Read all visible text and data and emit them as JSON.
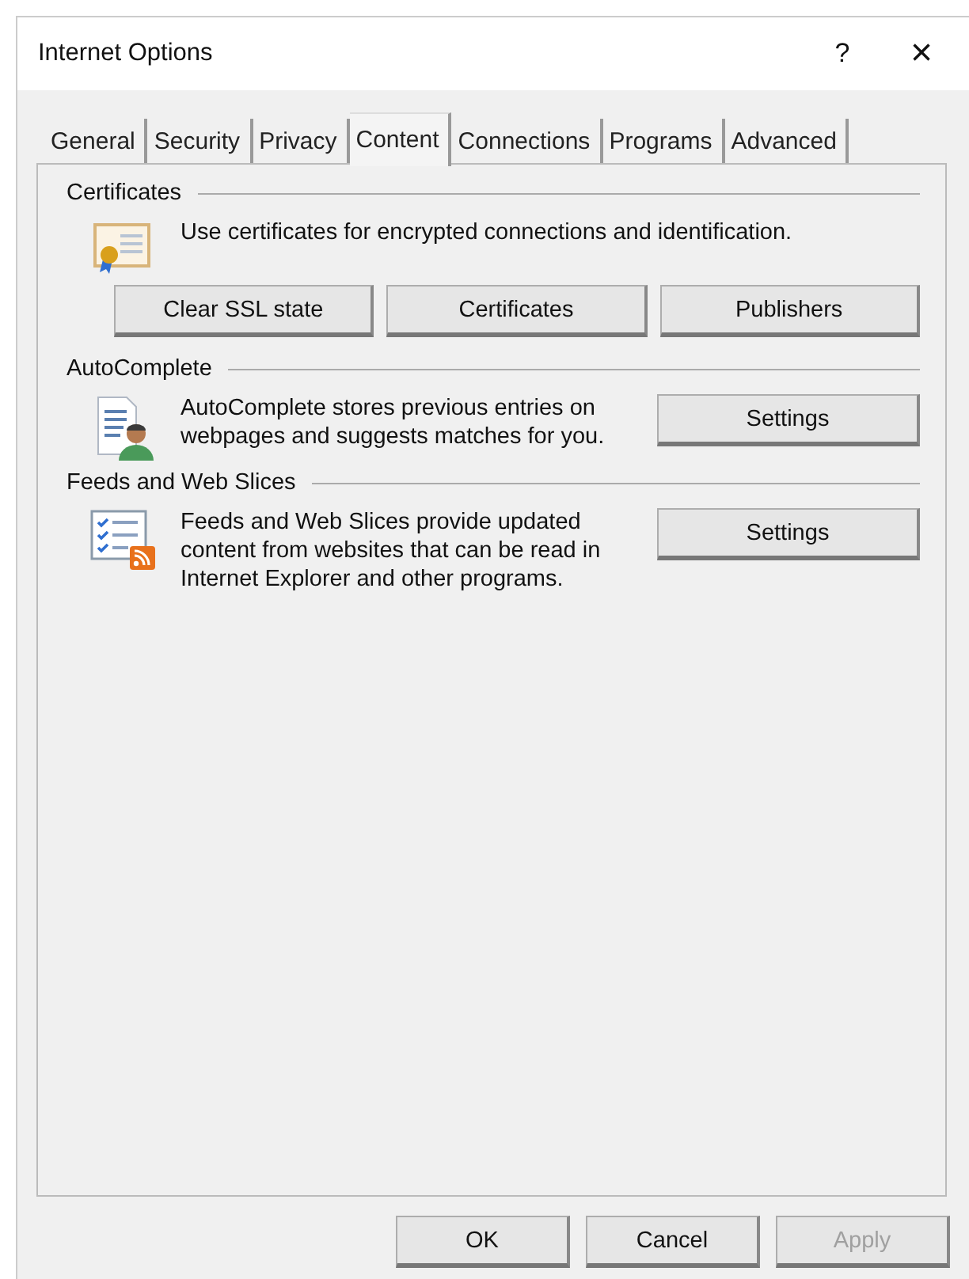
{
  "window": {
    "title": "Internet Options",
    "help": "?",
    "close": "×"
  },
  "tabs": [
    {
      "label": "General",
      "selected": false
    },
    {
      "label": "Security",
      "selected": false
    },
    {
      "label": "Privacy",
      "selected": false
    },
    {
      "label": "Content",
      "selected": true
    },
    {
      "label": "Connections",
      "selected": false
    },
    {
      "label": "Programs",
      "selected": false
    },
    {
      "label": "Advanced",
      "selected": false
    }
  ],
  "sections": [
    {
      "kind": "buttons_below",
      "title": "Certificates",
      "text": "Use certificates for encrypted connections and identification.",
      "buttons": [
        "Clear SSL state",
        "Certificates",
        "Publishers"
      ]
    },
    {
      "kind": "button_beside",
      "title": "AutoComplete",
      "text": "AutoComplete stores previous entries on webpages and suggests matches for you.",
      "buttons": [
        "Settings"
      ]
    },
    {
      "kind": "button_beside",
      "title": "Feeds and Web Slices",
      "text": "Feeds and Web Slices provide updated content from websites that can be read in Internet Explorer and other programs.",
      "buttons": [
        "Settings"
      ]
    }
  ],
  "buttons": [
    {
      "label": "OK",
      "disabled": false
    },
    {
      "label": "Cancel",
      "disabled": false
    },
    {
      "label": "Apply",
      "disabled": true
    }
  ]
}
